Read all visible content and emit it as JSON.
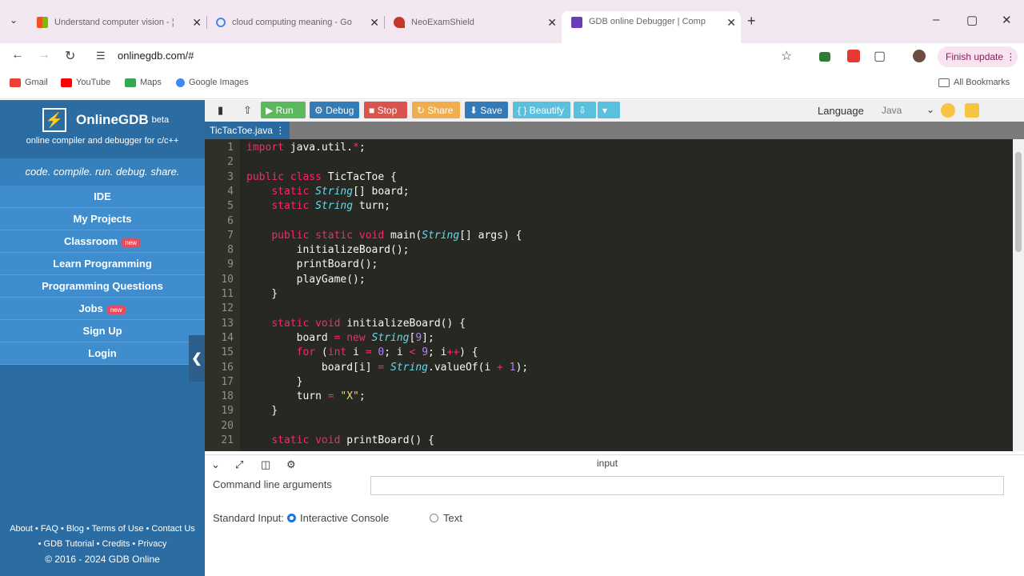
{
  "tabs": [
    {
      "title": "Understand computer vision - ¦",
      "favicon_color": "#e74c3c"
    },
    {
      "title": "cloud computing meaning - Go",
      "favicon_color": "#4285f4"
    },
    {
      "title": "NeoExamShield",
      "favicon_color": "#c0392b"
    },
    {
      "title": "GDB online Debugger | Comp",
      "favicon_color": "#6a3fb5"
    }
  ],
  "window": {
    "minimize": "–",
    "restore": "▢",
    "close": "✕",
    "new_tab": "+",
    "tab_close": "✕",
    "tab_dropdown": "⌄"
  },
  "address": {
    "url": "onlinegdb.com/#",
    "finish_update": "Finish update"
  },
  "bookmarks": [
    {
      "label": "Gmail",
      "color": "#ea4335"
    },
    {
      "label": "YouTube",
      "color": "#ff0000"
    },
    {
      "label": "Maps",
      "color": "#34a853"
    },
    {
      "label": "Google Images",
      "color": "#4285f4"
    }
  ],
  "all_bookmarks": "All Bookmarks",
  "sidebar": {
    "brand": "OnlineGDB",
    "beta": "beta",
    "subtitle": "online compiler and debugger for c/c++",
    "tagline": "code. compile. run. debug. share.",
    "menu": [
      {
        "label": "IDE",
        "new": ""
      },
      {
        "label": "My Projects",
        "new": ""
      },
      {
        "label": "Classroom",
        "new": "new"
      },
      {
        "label": "Learn Programming",
        "new": ""
      },
      {
        "label": "Programming Questions",
        "new": ""
      },
      {
        "label": "Jobs",
        "new": "new"
      },
      {
        "label": "Sign Up",
        "new": ""
      },
      {
        "label": "Login",
        "new": ""
      }
    ],
    "footer_line1": "About • FAQ • Blog • Terms of Use • Contact Us",
    "footer_line2": "• GDB Tutorial • Credits • Privacy",
    "footer_line3": "© 2016 - 2024 GDB Online"
  },
  "toolbar": {
    "run": "▶ Run",
    "debug": "⚙ Debug",
    "stop": "■ Stop",
    "share": "↻ Share",
    "save": "⬇ Save",
    "beautify": "{ } Beautify",
    "language_label": "Language",
    "language_value": "Java",
    "colors": {
      "run": "#5cb85c",
      "debug": "#337ab7",
      "stop": "#d9534f",
      "share": "#f0ad4e",
      "save": "#337ab7",
      "beautify": "#5bc0de"
    }
  },
  "file": {
    "name": "TicTacToe.java ⋮"
  },
  "code_lines": [
    {
      "n": "1",
      "html": "<span class=\"kw\">import</span> java.util.<span class=\"kw\">*</span>;"
    },
    {
      "n": "2",
      "html": ""
    },
    {
      "n": "3",
      "html": "<span class=\"kw\">public</span> <span class=\"kw\">class</span> TicTacToe {"
    },
    {
      "n": "4",
      "html": "    <span class=\"kw\">static</span> <span class=\"cls\">String</span>[] board;"
    },
    {
      "n": "5",
      "html": "    <span class=\"kw\">static</span> <span class=\"cls\">String</span> turn;"
    },
    {
      "n": "6",
      "html": ""
    },
    {
      "n": "7",
      "html": "    <span class=\"kw\">public</span> <span class=\"kw\">static</span> <span class=\"kw\">void</span> main(<span class=\"cls\">String</span>[] args) {"
    },
    {
      "n": "8",
      "html": "        initializeBoard();"
    },
    {
      "n": "9",
      "html": "        printBoard();"
    },
    {
      "n": "10",
      "html": "        playGame();"
    },
    {
      "n": "11",
      "html": "    }"
    },
    {
      "n": "12",
      "html": ""
    },
    {
      "n": "13",
      "html": "    <span class=\"kw\">static</span> <span class=\"kw\">void</span> initializeBoard() {"
    },
    {
      "n": "14",
      "html": "        board <span class=\"kw\">=</span> <span class=\"kw\">new</span> <span class=\"cls\">String</span>[<span class=\"num\">9</span>];"
    },
    {
      "n": "15",
      "html": "        <span class=\"kw\">for</span> (<span class=\"kw\">int</span> i <span class=\"kw\">=</span> <span class=\"num\">0</span>; i <span class=\"kw\">&lt;</span> <span class=\"num\">9</span>; i<span class=\"kw\">++</span>) {"
    },
    {
      "n": "16",
      "html": "            board[i] <span class=\"kw\">=</span> <span class=\"cls\">String</span>.valueOf(i <span class=\"kw\">+</span> <span class=\"num\">1</span>);"
    },
    {
      "n": "17",
      "html": "        }"
    },
    {
      "n": "18",
      "html": "        turn <span class=\"kw\">=</span> <span class=\"str\">\"X\"</span>;"
    },
    {
      "n": "19",
      "html": "    }"
    },
    {
      "n": "20",
      "html": ""
    },
    {
      "n": "21",
      "html": "    <span class=\"kw\">static</span> <span class=\"kw\">void</span> printBoard() {"
    }
  ],
  "panel": {
    "title": "input",
    "cmd_label": "Command line arguments",
    "cmd_value": "",
    "std_label": "Standard Input:",
    "opt_interactive": "Interactive Console",
    "opt_text": "Text"
  }
}
